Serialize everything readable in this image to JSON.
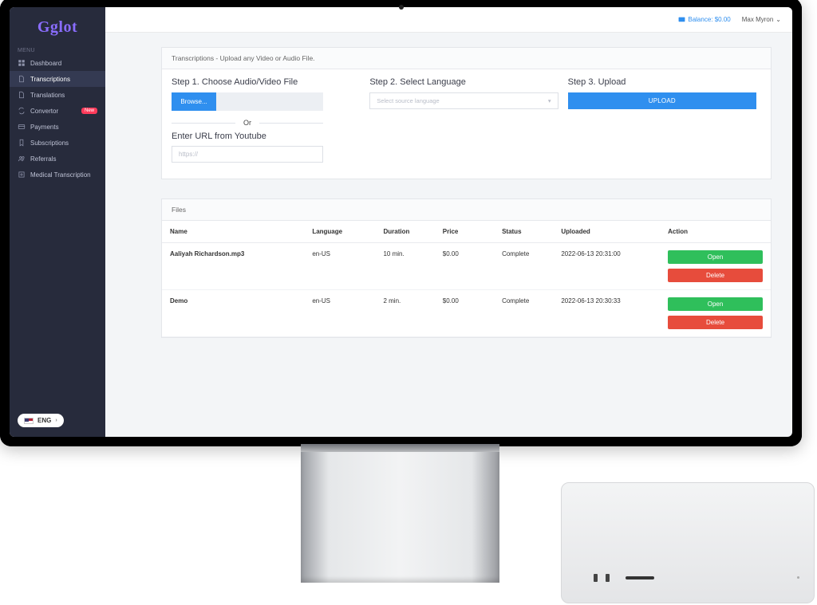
{
  "brand": "Gglot",
  "sidebar": {
    "menu_label": "MENU",
    "items": [
      {
        "icon": "dashboard-icon",
        "label": "Dashboard"
      },
      {
        "icon": "file-icon",
        "label": "Transcriptions",
        "active": true
      },
      {
        "icon": "file-icon",
        "label": "Translations"
      },
      {
        "icon": "sync-icon",
        "label": "Convertor",
        "badge": "New"
      },
      {
        "icon": "card-icon",
        "label": "Payments"
      },
      {
        "icon": "bookmark-icon",
        "label": "Subscriptions"
      },
      {
        "icon": "users-icon",
        "label": "Referrals"
      },
      {
        "icon": "medical-icon",
        "label": "Medical Transcription"
      }
    ],
    "language": "ENG"
  },
  "header": {
    "balance_label": "Balance: $0.00",
    "user_name": "Max Myron"
  },
  "upload_card": {
    "title": "Transcriptions - Upload any Video or Audio File.",
    "step1": {
      "title": "Step 1. Choose Audio/Video File",
      "browse": "Browse...",
      "or": "Or",
      "youtube_label": "Enter URL from Youtube",
      "placeholder": "https://"
    },
    "step2": {
      "title": "Step 2. Select Language",
      "placeholder": "Select source language"
    },
    "step3": {
      "title": "Step 3. Upload",
      "button": "UPLOAD"
    }
  },
  "files_card": {
    "title": "Files",
    "columns": {
      "name": "Name",
      "language": "Language",
      "duration": "Duration",
      "price": "Price",
      "status": "Status",
      "uploaded": "Uploaded",
      "action": "Action"
    },
    "rows": [
      {
        "name": "Aaliyah Richardson.mp3",
        "language": "en-US",
        "duration": "10 min.",
        "price": "$0.00",
        "status": "Complete",
        "uploaded": "2022-06-13 20:31:00"
      },
      {
        "name": "Demo",
        "language": "en-US",
        "duration": "2 min.",
        "price": "$0.00",
        "status": "Complete",
        "uploaded": "2022-06-13 20:30:33"
      }
    ],
    "open_label": "Open",
    "delete_label": "Delete"
  }
}
